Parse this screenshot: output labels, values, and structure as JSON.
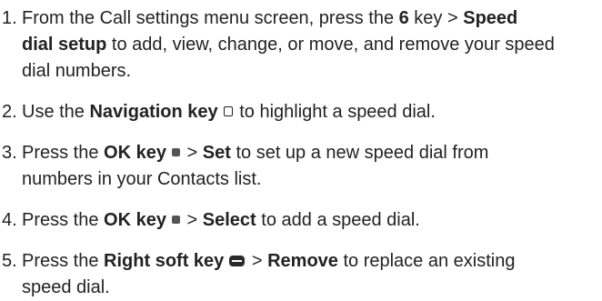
{
  "steps": [
    {
      "number": "1.",
      "t1": "From the Call settings menu screen, press the ",
      "b1": "6",
      "t2": " key > ",
      "b2": "Speed",
      "b3": "dial setup",
      "t3": " to add, view, change, or move, and remove your speed",
      "t4": "dial numbers."
    },
    {
      "number": "2.",
      "t1": "Use the ",
      "b1": "Navigation key",
      "icon": "navigation-key-icon",
      "t2": " to highlight a speed dial."
    },
    {
      "number": "3.",
      "t1": "Press the ",
      "b1": "OK key",
      "icon": "ok-key-icon",
      "t2": " > ",
      "b2": "Set",
      "t3": " to set up a new speed dial from",
      "t4": "numbers in your Contacts list."
    },
    {
      "number": "4.",
      "t1": "Press the ",
      "b1": "OK key",
      "icon": "ok-key-icon",
      "t2": " > ",
      "b2": "Select",
      "t3": " to add a speed dial."
    },
    {
      "number": "5.",
      "t1": "Press the ",
      "b1": "Right soft key",
      "icon": "right-soft-key-icon",
      "t2": " > ",
      "b2": "Remove",
      "t3": " to replace an existing",
      "t4": "speed dial."
    }
  ]
}
